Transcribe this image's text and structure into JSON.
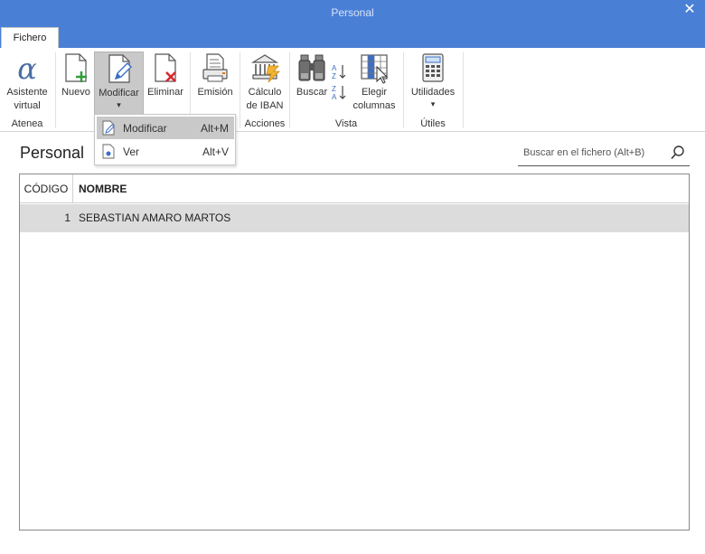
{
  "window": {
    "title": "Personal",
    "close_glyph": "✕"
  },
  "tabs": [
    {
      "label": "Fichero",
      "active": true
    }
  ],
  "ribbon": {
    "groups": [
      {
        "label": "Atenea"
      },
      {
        "label": "Acciones"
      },
      {
        "label": "Vista"
      },
      {
        "label": "Útiles"
      }
    ],
    "buttons": {
      "asistente": {
        "label_line1": "Asistente",
        "label_line2": "virtual",
        "icon": "alpha-icon"
      },
      "nuevo": {
        "label": "Nuevo",
        "icon": "new-document-icon"
      },
      "modificar": {
        "label": "Modificar",
        "icon": "edit-document-icon",
        "arrow": "▾"
      },
      "eliminar": {
        "label": "Eliminar",
        "icon": "delete-document-icon"
      },
      "emision": {
        "label": "Emisión",
        "icon": "print-icon"
      },
      "iban": {
        "label_line1": "Cálculo",
        "label_line2": "de IBAN",
        "icon": "bank-icon"
      },
      "buscar": {
        "label": "Buscar",
        "icon": "binoculars-icon"
      },
      "sort_asc": {
        "icon": "sort-az-icon"
      },
      "sort_desc": {
        "icon": "sort-za-icon"
      },
      "elegir": {
        "label_line1": "Elegir",
        "label_line2": "columnas",
        "icon": "choose-columns-icon"
      },
      "utilidades": {
        "label": "Utilidades",
        "icon": "calculator-icon",
        "arrow": "▾"
      }
    }
  },
  "dropdown": {
    "items": [
      {
        "label": "Modificar",
        "shortcut": "Alt+M",
        "icon": "edit-icon",
        "highlighted": true
      },
      {
        "label": "Ver",
        "shortcut": "Alt+V",
        "icon": "view-icon",
        "highlighted": false
      }
    ]
  },
  "page": {
    "title": "Personal"
  },
  "search": {
    "placeholder": "Buscar en el fichero (Alt+B)",
    "value": "",
    "icon": "search-icon"
  },
  "table": {
    "columns": [
      "CÓDIGO",
      "NOMBRE"
    ],
    "rows": [
      {
        "codigo": "1",
        "nombre": "SEBASTIAN AMARO MARTOS",
        "selected": true
      }
    ]
  },
  "colors": {
    "titlebar": "#4a7fd6",
    "accent_green": "#2e9e3a",
    "accent_red": "#d9262c",
    "accent_blue": "#3a6fc4",
    "selection_gray": "#c9c9c9",
    "row_gray": "#dcdcdc"
  }
}
